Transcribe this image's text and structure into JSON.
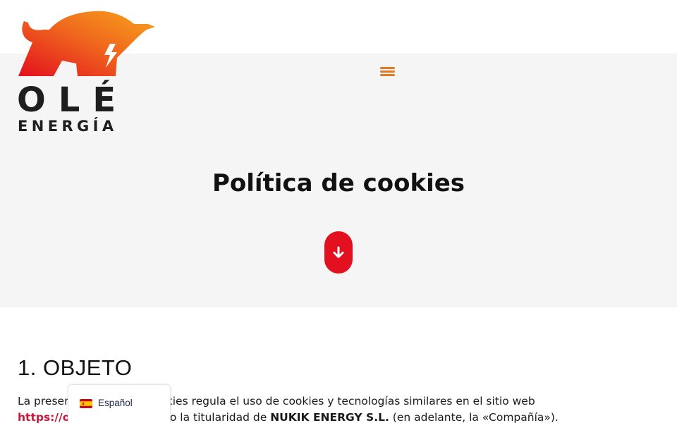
{
  "brand": {
    "logo_text_main": "OLÉ",
    "logo_text_sub": "ENERGÍA",
    "colors": {
      "bull_gradient_start": "#e3101f",
      "bull_gradient_end": "#f7a51c",
      "logo_text": "#1e1e1e",
      "menu_icon": "#e4791f",
      "accent_red": "#e3101f",
      "link": "#d0143a"
    }
  },
  "header": {
    "menu_icon": "hamburger-menu-icon"
  },
  "hero": {
    "title": "Política de cookies",
    "scroll_icon": "arrow-down-icon"
  },
  "content": {
    "section_heading": "1. OBJETO",
    "paragraph": {
      "line1": "La presente Política de Cookies regula el uso de cookies y tecnologías similares en el sitio web",
      "link_text": "https://oleenergia.es",
      "line2_mid": ", bajo la titularidad de ",
      "company": "NUKIK ENERGY S.L.",
      "line2_end": " (en adelante, la «Compañía»)."
    }
  },
  "language_switcher": {
    "current": "Español",
    "flag_icon": "spain-flag-icon"
  }
}
